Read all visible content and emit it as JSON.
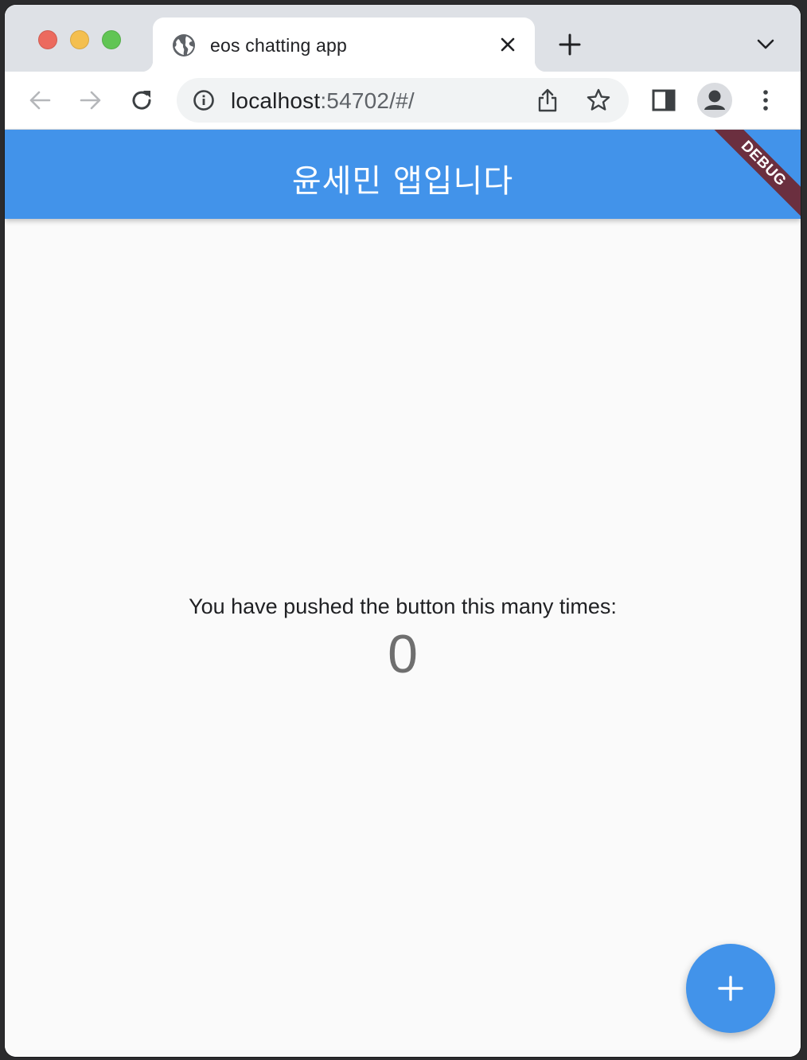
{
  "browser": {
    "tab": {
      "title": "eos chatting app",
      "favicon": "globe-icon"
    },
    "toolbar": {
      "url_host": "localhost",
      "url_rest": ":54702/#/"
    }
  },
  "app": {
    "appbar_title": "윤세민 앱입니다",
    "debug_banner": "DEBUG",
    "counter_label": "You have pushed the button this many times:",
    "counter_value": "0",
    "fab_icon": "plus-icon",
    "colors": {
      "primary": "#4293ea",
      "debug_banner": "#6b2f3f",
      "background": "#fafafa"
    }
  }
}
